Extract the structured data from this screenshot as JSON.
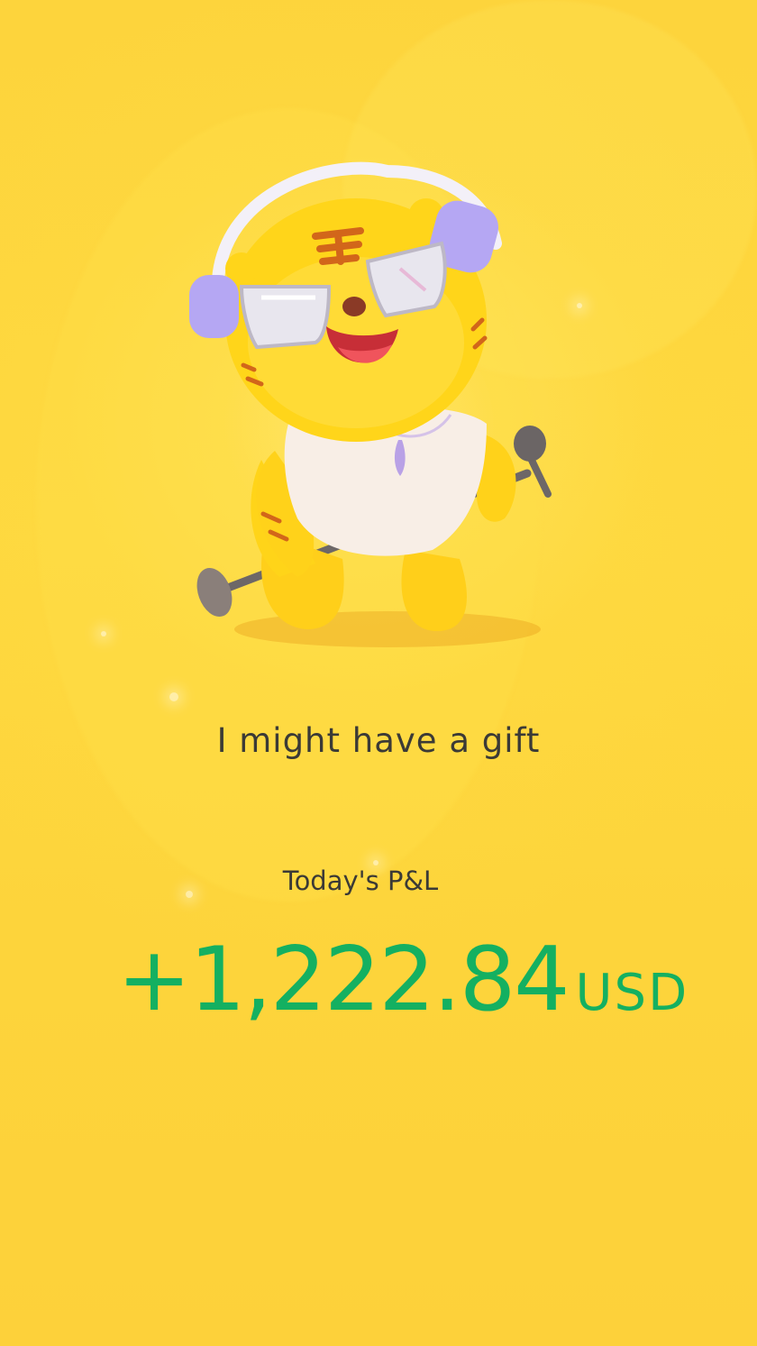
{
  "headline": "I might have a gift",
  "pnl": {
    "label": "Today's P&L",
    "value": "+1,222.84",
    "currency": "USD"
  },
  "mascot": {
    "icon": "tiger-mascot-icon",
    "colors": {
      "body": "#ffd318",
      "headphones": "#b5a7f3",
      "shirt": "#f8eee6",
      "mouth": "#f0545c",
      "stripes": "#d2661a"
    }
  },
  "colors": {
    "background": "#fdd53a",
    "text": "#3b3a36",
    "profit": "#14b061"
  }
}
